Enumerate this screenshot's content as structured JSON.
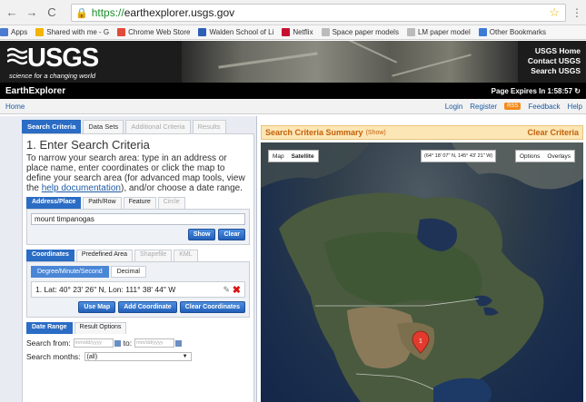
{
  "browser": {
    "url_scheme": "https://",
    "url_host": "earthexplorer.usgs.gov",
    "bookmarks": [
      {
        "label": "Apps",
        "color": "#4a7bd1"
      },
      {
        "label": "Shared with me - G",
        "color": "#f4b400"
      },
      {
        "label": "Chrome Web Store",
        "color": "#e24a3b"
      },
      {
        "label": "Walden School of Li",
        "color": "#2b5fb8"
      },
      {
        "label": "Netflix",
        "color": "#c8102e"
      },
      {
        "label": "Space paper models",
        "color": "#bbbbbb"
      },
      {
        "label": "LM paper model",
        "color": "#bbbbbb"
      },
      {
        "label": "Other Bookmarks",
        "color": "#3c7bd6"
      }
    ]
  },
  "header": {
    "logo_word": "USGS",
    "tagline": "science for a changing world",
    "links": [
      "USGS Home",
      "Contact USGS",
      "Search USGS"
    ],
    "app_name": "EarthExplorer",
    "expires": "Page Expires In 1:58:57"
  },
  "subnav": {
    "home": "Home",
    "login": "Login",
    "register": "Register",
    "rss": "RSS",
    "feedback": "Feedback",
    "help": "Help"
  },
  "tabs": [
    "Search Criteria",
    "Data Sets",
    "Additional Criteria",
    "Results"
  ],
  "criteria": {
    "title": "1. Enter Search Criteria",
    "desc_before": "To narrow your search area: type in an address or place name, enter coordinates or click the map to define your search area (for advanced map tools, view the ",
    "desc_link": "help documentation",
    "desc_after": "), and/or choose a date range."
  },
  "address": {
    "tabs": [
      "Address/Place",
      "Path/Row",
      "Feature",
      "Circle"
    ],
    "value": "mount timpanogas",
    "show": "Show",
    "clear": "Clear"
  },
  "coordinates": {
    "tabs": [
      "Coordinates",
      "Predefined Area",
      "Shapefile",
      "KML"
    ],
    "formats": [
      "Degree/Minute/Second",
      "Decimal"
    ],
    "entry": "1.  Lat: 40° 23' 26\" N, Lon: 111° 38' 44\" W",
    "use_map": "Use Map",
    "add": "Add Coordinate",
    "clear": "Clear Coordinates"
  },
  "date": {
    "tabs": [
      "Date Range",
      "Result Options"
    ],
    "from_label": "Search from:",
    "to_label": "to:",
    "placeholder": "mm/dd/yyyy",
    "months_label": "Search months:",
    "months_value": "(all)"
  },
  "summary": {
    "title": "Search Criteria Summary",
    "show": "(Show)",
    "clear": "Clear Criteria"
  },
  "map": {
    "types": [
      "Map",
      "Satellite"
    ],
    "coord_readout": "(64° 18' 07\" N, 145° 43' 21\" W)",
    "options": "Options",
    "overlays": "Overlays",
    "marker_label": "1"
  }
}
